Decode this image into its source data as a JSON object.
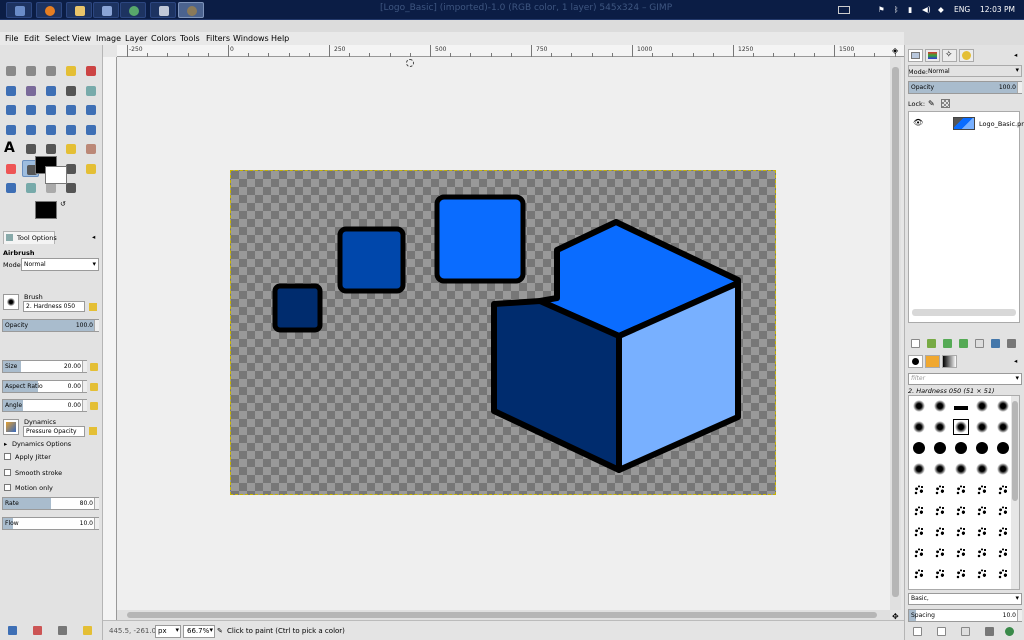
{
  "taskbar": {
    "title": "[Logo_Basic] (imported)-1.0 (RGB color, 1 layer) 545x324 – GIMP",
    "language": "ENG",
    "clock": "12:03 PM"
  },
  "menu": [
    "File",
    "Edit",
    "Select",
    "View",
    "Image",
    "Layer",
    "Colors",
    "Tools",
    "Filters",
    "Windows",
    "Help"
  ],
  "ruler": {
    "labels": [
      "-250",
      "0",
      "250",
      "500",
      "750",
      "1000",
      "1250",
      "1500"
    ]
  },
  "tool_options": {
    "tab_label": "Tool Options",
    "tool_name": "Airbrush",
    "mode_label": "Mode:",
    "mode_value": "Normal",
    "opacity_label": "Opacity",
    "opacity_value": "100.0",
    "brush_label": "Brush",
    "brush_value": "2. Hardness 050",
    "size_label": "Size",
    "size_value": "20.00",
    "aspect_label": "Aspect Ratio",
    "aspect_value": "0.00",
    "angle_label": "Angle",
    "angle_value": "0.00",
    "dynamics_label": "Dynamics",
    "dynamics_value": "Pressure Opacity",
    "dynamics_options": "Dynamics Options",
    "apply_jitter": "Apply Jitter",
    "smooth_stroke": "Smooth stroke",
    "motion_only": "Motion only",
    "rate_label": "Rate",
    "rate_value": "80.0",
    "flow_label": "Flow",
    "flow_value": "10.0"
  },
  "status": {
    "coords": "445.5, -261.0",
    "unit": "px",
    "zoom": "66.7%",
    "message": "Click to paint (Ctrl to pick a color)"
  },
  "layers_panel": {
    "mode_label": "Mode:",
    "mode_value": "Normal",
    "opacity_label": "Opacity",
    "opacity_value": "100.0",
    "lock_label": "Lock:",
    "layer_name": "Logo_Basic.png"
  },
  "brushes_panel": {
    "filter_placeholder": "filter",
    "selected_brush": "2. Hardness 050 (51 × 51)",
    "tag_value": "Basic,",
    "spacing_label": "Spacing",
    "spacing_value": "10.0"
  },
  "colors": {
    "light_blue": "#0a6cff",
    "mid_blue": "#0047ab",
    "dark_blue": "#002c6e",
    "pale_blue": "#78b0ff"
  }
}
